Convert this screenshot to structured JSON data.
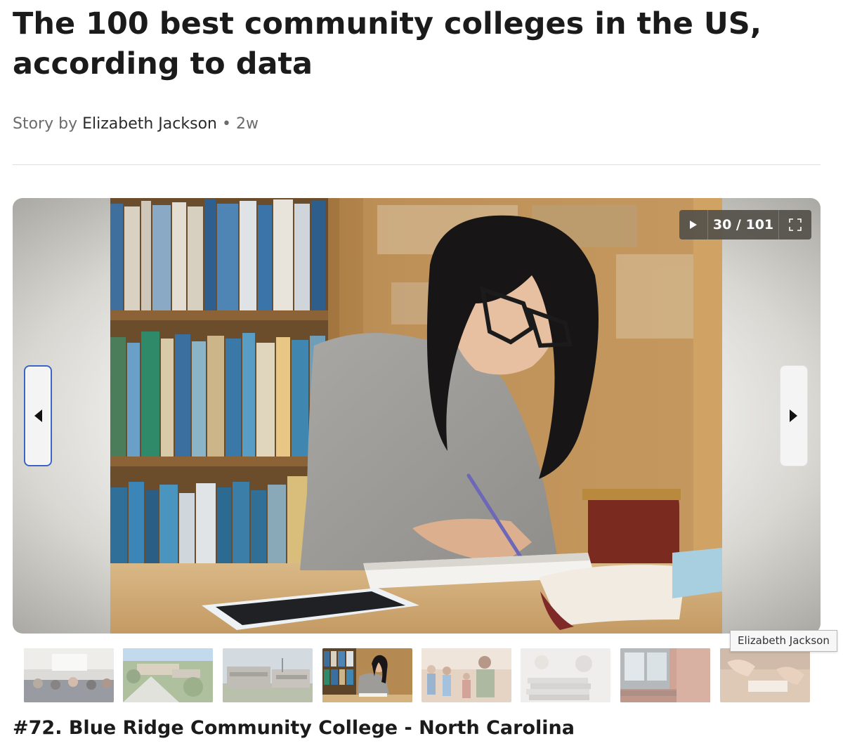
{
  "article": {
    "title": "The 100 best community colleges in the US, according to data",
    "byline": {
      "prefix": "Story by",
      "author": "Elizabeth Jackson",
      "separator": "•",
      "age": "2w"
    }
  },
  "slideshow": {
    "counter": "30 / 101",
    "current_slide": 30,
    "total_slides": 101,
    "caption": "#72. Blue Ridge Community College - North Carolina",
    "tooltip": "Elizabeth Jackson",
    "controls": {
      "play_icon": "play-icon",
      "fullscreen_icon": "fullscreen-icon",
      "prev_icon": "arrow-left-icon",
      "next_icon": "arrow-right-icon"
    },
    "thumbnails": [
      {
        "subject": "lecture-hall",
        "active": false
      },
      {
        "subject": "campus-aerial",
        "active": false
      },
      {
        "subject": "campus-building",
        "active": false
      },
      {
        "subject": "student-in-library",
        "active": true
      },
      {
        "subject": "students-outdoors",
        "active": false
      },
      {
        "subject": "paper-stacks",
        "active": false
      },
      {
        "subject": "technical-college-building",
        "active": false
      },
      {
        "subject": "hands-on-table",
        "active": false
      }
    ]
  },
  "colors": {
    "focus_ring": "#3a64c8",
    "controls_background": "#54504a",
    "text_primary": "#1b1b1b",
    "text_muted": "#6b6b6b"
  }
}
